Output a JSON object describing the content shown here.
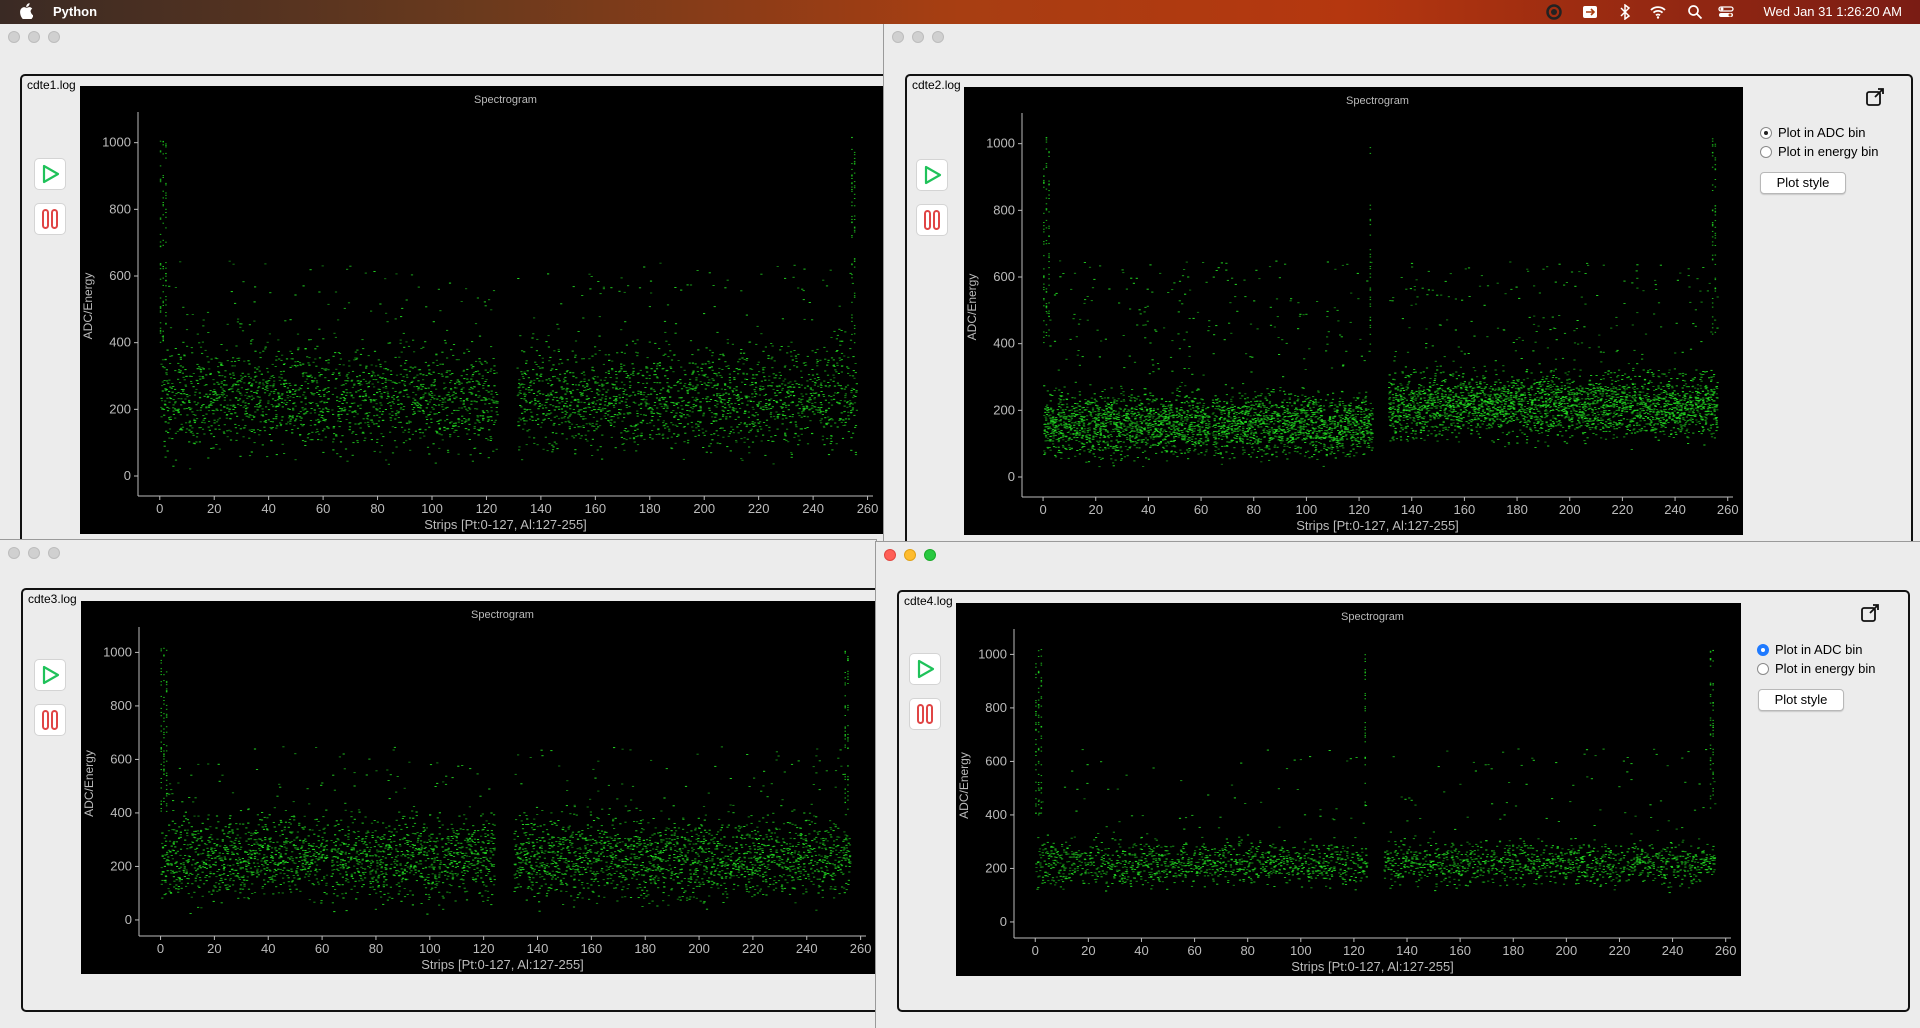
{
  "menubar": {
    "app_name": "Python",
    "clock": "Wed Jan 31  1:26:20 AM",
    "icons": [
      "apple-icon",
      "record-icon",
      "screen-share-icon",
      "bluetooth-icon",
      "wifi-icon",
      "search-icon",
      "control-center-icon"
    ]
  },
  "windows": [
    {
      "id": "w1",
      "panel_label": "cdte1.log",
      "plot_title": "Spectrogram",
      "xlabel": "Strips [Pt:0-127, Al:127-255]",
      "ylabel": "ADC/Energy",
      "xticks": [
        "0",
        "20",
        "40",
        "60",
        "80",
        "100",
        "120",
        "140",
        "160",
        "180",
        "200",
        "220",
        "240",
        "260"
      ],
      "yticks": [
        "0",
        "200",
        "400",
        "600",
        "800",
        "1000"
      ],
      "play_icon": "play-icon",
      "pause_icon": "pause-icon"
    },
    {
      "id": "w2",
      "panel_label": "cdte2.log",
      "plot_title": "Spectrogram",
      "xlabel": "Strips [Pt:0-127, Al:127-255]",
      "ylabel": "ADC/Energy",
      "xticks": [
        "0",
        "20",
        "40",
        "60",
        "80",
        "100",
        "120",
        "140",
        "160",
        "180",
        "200",
        "220",
        "240",
        "260"
      ],
      "yticks": [
        "0",
        "200",
        "400",
        "600",
        "800",
        "1000"
      ],
      "radio_adc": "Plot in ADC bin",
      "radio_energy": "Plot in energy bin",
      "plot_style": "Plot style",
      "selected": "adc"
    },
    {
      "id": "w3",
      "panel_label": "cdte3.log",
      "plot_title": "Spectrogram",
      "xlabel": "Strips [Pt:0-127, Al:127-255]",
      "ylabel": "ADC/Energy",
      "xticks": [
        "0",
        "20",
        "40",
        "60",
        "80",
        "100",
        "120",
        "140",
        "160",
        "180",
        "200",
        "220",
        "240",
        "260"
      ],
      "yticks": [
        "0",
        "200",
        "400",
        "600",
        "800",
        "1000"
      ]
    },
    {
      "id": "w4",
      "panel_label": "cdte4.log",
      "plot_title": "Spectrogram",
      "xlabel": "Strips [Pt:0-127, Al:127-255]",
      "ylabel": "ADC/Energy",
      "xticks": [
        "0",
        "20",
        "40",
        "60",
        "80",
        "100",
        "120",
        "140",
        "160",
        "180",
        "200",
        "220",
        "240",
        "260"
      ],
      "yticks": [
        "0",
        "200",
        "400",
        "600",
        "800",
        "1000"
      ],
      "radio_adc": "Plot in ADC bin",
      "radio_energy": "Plot in energy bin",
      "plot_style": "Plot style",
      "selected": "adc"
    }
  ],
  "colors": {
    "plot_bg": "#000000",
    "data_green": "#22dd22",
    "axis": "#bbbbbb",
    "play_green": "#1fc25a",
    "pause_red": "#e04545"
  }
}
